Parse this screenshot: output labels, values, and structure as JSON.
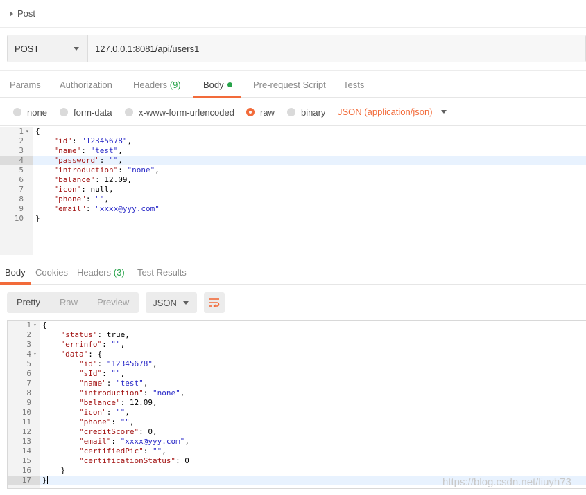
{
  "request": {
    "title": "Post",
    "method": "POST",
    "url": "127.0.0.1:8081/api/users1"
  },
  "request_tabs": [
    {
      "label": "Params"
    },
    {
      "label": "Authorization"
    },
    {
      "label": "Headers",
      "count": "(9)"
    },
    {
      "label": "Body"
    },
    {
      "label": "Pre-request Script"
    },
    {
      "label": "Tests"
    }
  ],
  "body_options": {
    "none": "none",
    "form_data": "form-data",
    "urlencoded": "x-www-form-urlencoded",
    "raw": "raw",
    "binary": "binary",
    "content_type": "JSON (application/json)",
    "selected": "raw"
  },
  "request_body_lines": [
    "{",
    "    \"id\": \"12345678\",",
    "    \"name\": \"test\",",
    "    \"password\": \"\",",
    "    \"introduction\": \"none\",",
    "    \"balance\": 12.09,",
    "    \"icon\": null,",
    "    \"phone\": \"\",",
    "    \"email\": \"xxxx@yyy.com\"",
    "}"
  ],
  "response_tabs": [
    {
      "label": "Body"
    },
    {
      "label": "Cookies"
    },
    {
      "label": "Headers",
      "count": "(3)"
    },
    {
      "label": "Test Results"
    }
  ],
  "response_view": {
    "pretty": "Pretty",
    "raw": "Raw",
    "preview": "Preview",
    "format": "JSON"
  },
  "response_body_lines": [
    "{",
    "    \"status\": true,",
    "    \"errinfo\": \"\",",
    "    \"data\": {",
    "        \"id\": \"12345678\",",
    "        \"sId\": \"\",",
    "        \"name\": \"test\",",
    "        \"introduction\": \"none\",",
    "        \"balance\": 12.09,",
    "        \"icon\": \"\",",
    "        \"phone\": \"\",",
    "        \"creditScore\": 0,",
    "        \"email\": \"xxxx@yyy.com\",",
    "        \"certifiedPic\": \"\",",
    "        \"certificationStatus\": 0",
    "    }",
    "}"
  ],
  "watermark": "https://blog.csdn.net/liuyh73",
  "colors": {
    "accent": "#f26b3a",
    "count_green": "#27a34a"
  }
}
